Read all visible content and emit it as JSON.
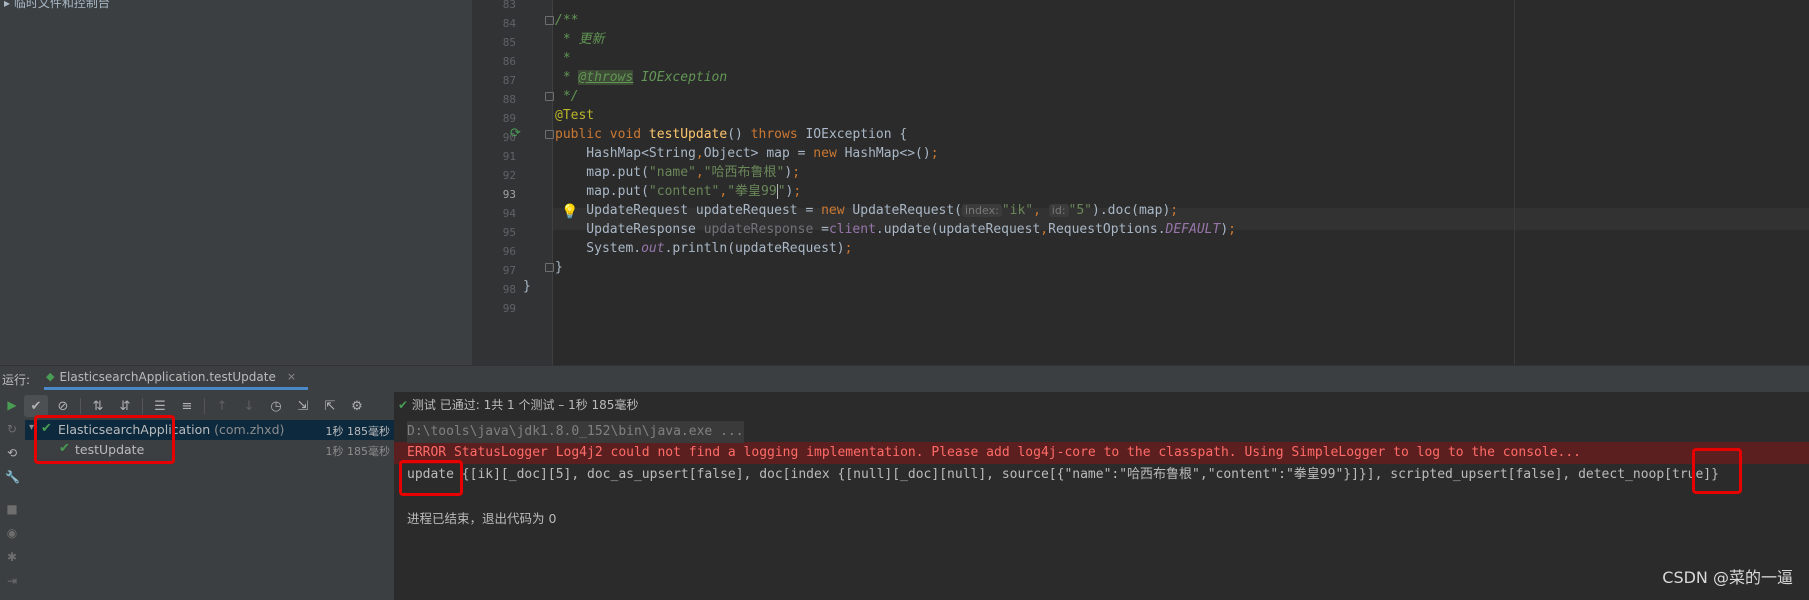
{
  "project": {
    "crumb": "▸ 临时文件和控制台"
  },
  "editor": {
    "line_numbers": [
      "83",
      "84",
      "85",
      "86",
      "87",
      "88",
      "89",
      "90",
      "91",
      "92",
      "93",
      "94",
      "95",
      "96",
      "97",
      "98",
      "99"
    ],
    "current_line": "93",
    "hints": {
      "index": "index:",
      "id": "id:"
    }
  },
  "run": {
    "label": "运行:",
    "tab_title": "ElasticsearchApplication.testUpdate",
    "close": "×",
    "status": "测试 已通过: 1共 1 个测试 – 1秒 185毫秒",
    "tree": [
      {
        "name": "ElasticsearchApplication",
        "pkg": "(com.zhxd)",
        "duration": "1秒 185毫秒"
      },
      {
        "name": "testUpdate",
        "duration": "1秒 185毫秒"
      }
    ]
  },
  "console": {
    "line1": "D:\\tools\\java\\jdk1.8.0_152\\bin\\java.exe ...",
    "line2": "ERROR StatusLogger Log4j2 could not find a logging implementation. Please add log4j-core to the classpath. Using SimpleLogger to log to the console...",
    "line3": "update {[ik][_doc][5], doc_as_upsert[false], doc[index {[null][_doc][null], source[{\"name\":\"哈西布鲁根\",\"content\":\"拳皇99\"}]}], scripted_upsert[false], detect_noop[true]}",
    "line4": "进程已结束，退出代码为 0"
  },
  "watermark": "CSDN @菜的一逼",
  "colors": {
    "error_text": "#ff6b68",
    "highlight_box": "#e60000",
    "pass_green": "#499c54"
  }
}
